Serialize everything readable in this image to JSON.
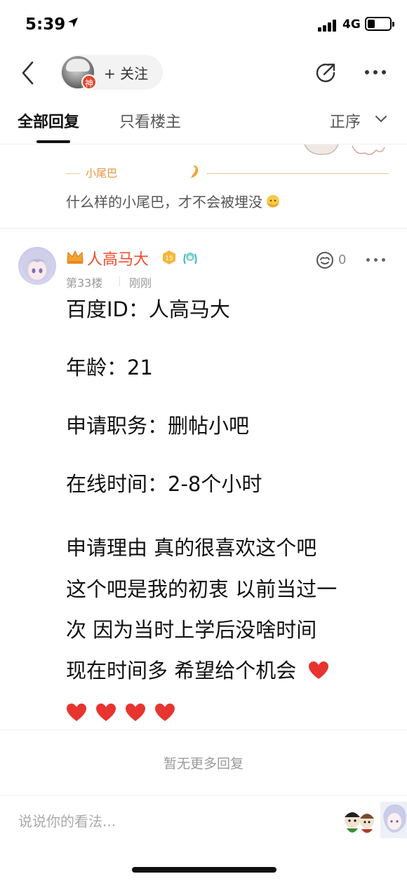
{
  "status_bar": {
    "time": "5:39",
    "network": "4G"
  },
  "header": {
    "follow_label": "+ 关注",
    "god_badge": "神",
    "icons": [
      "back-arrow-icon",
      "share-icon",
      "more-icon"
    ]
  },
  "tabs": {
    "all": "全部回复",
    "owner_only": "只看楼主",
    "sort": "正序"
  },
  "previous_post": {
    "tail_label": "小尾巴",
    "tail_text": "什么样的小尾巴，才不会被埋没"
  },
  "reply": {
    "username": "人高马大",
    "level": "15",
    "floor": "第33楼",
    "time": "刚刚",
    "like_count": "0",
    "lines": [
      "百度ID：人高马大",
      "年龄：21",
      "申请职务：删帖小吧",
      "在线时间：2-8个小时",
      "申请理由 真的很喜欢这个吧",
      "这个吧是我的初衷 以前当过一",
      "次 因为当时上学后没啥时间",
      "现在时间多 希望给个机会"
    ],
    "heart_color": "#e8342f"
  },
  "footer": {
    "no_more": "暂无更多回复",
    "comment_placeholder": "说说你的看法..."
  },
  "colors": {
    "accent_red": "#f04b2f",
    "tail_orange": "#e8923a",
    "text_gray": "#999999"
  }
}
